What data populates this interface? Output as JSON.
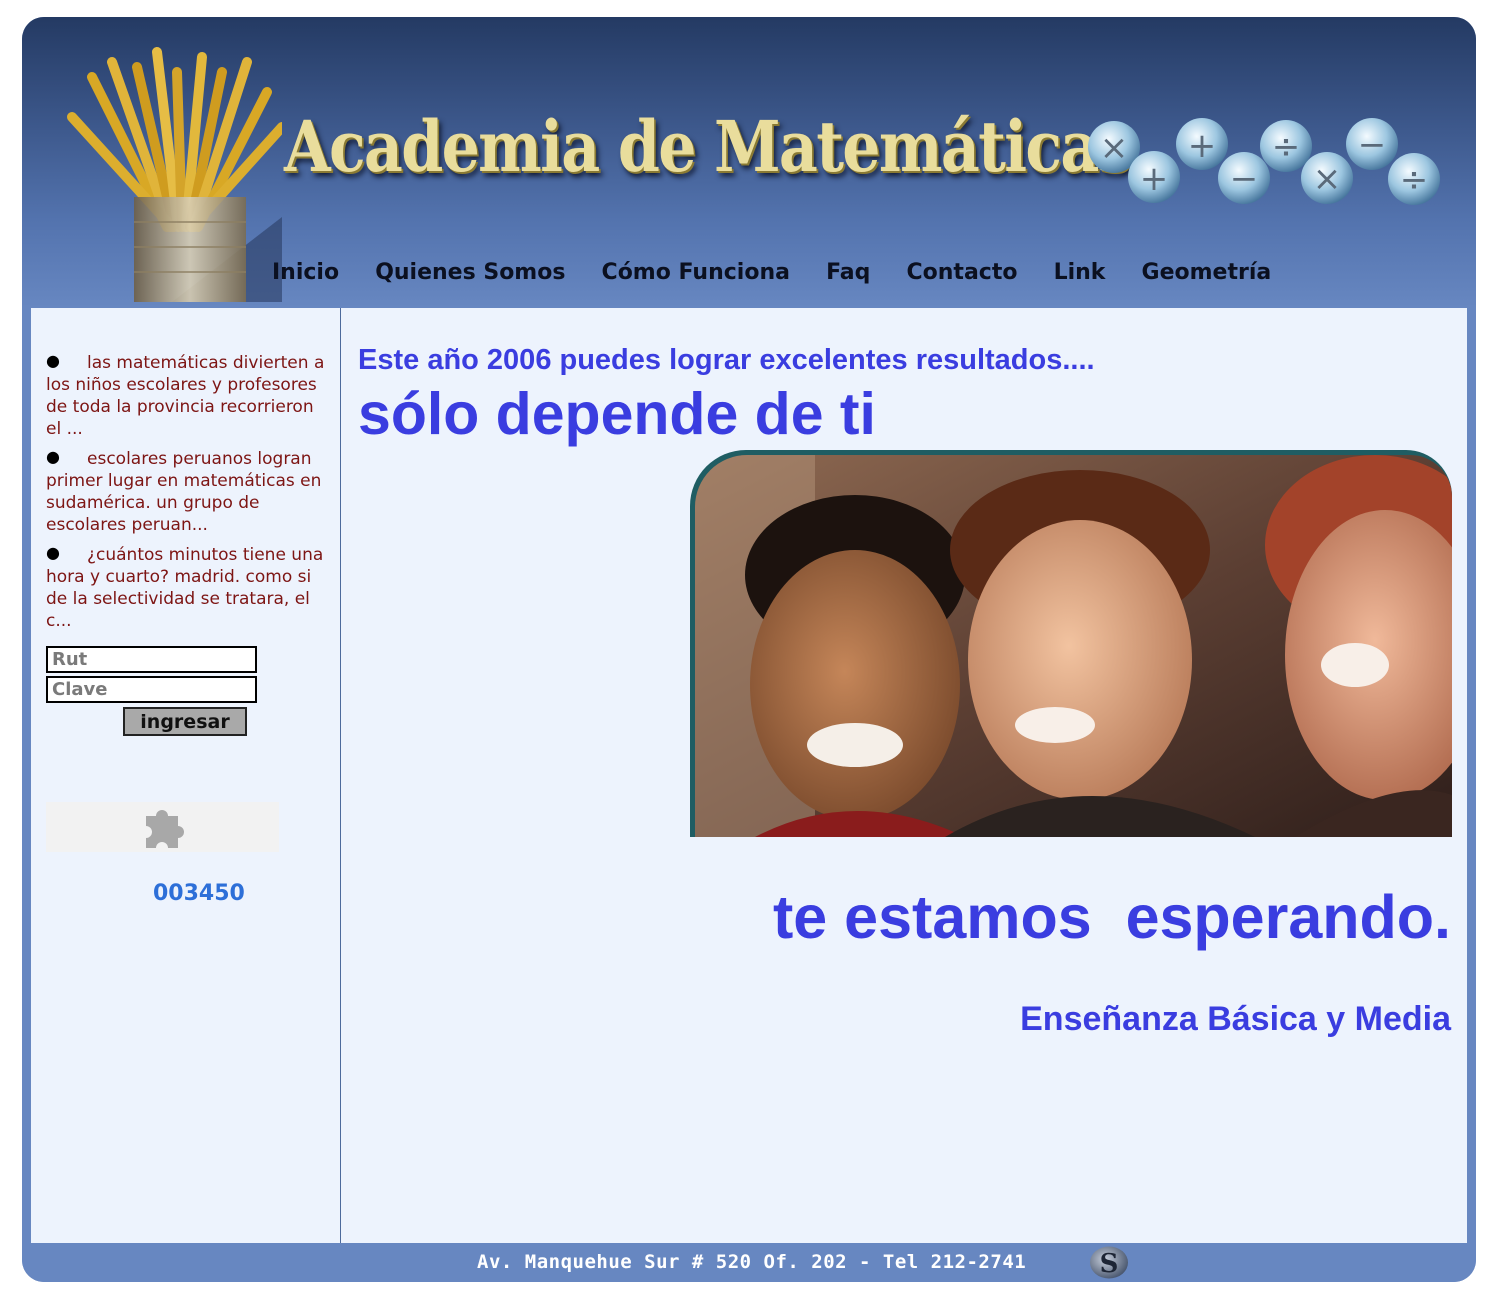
{
  "header": {
    "title": "Academia de Matemáticas"
  },
  "nav": {
    "items": [
      "Inicio",
      "Quienes Somos",
      "Cómo Funciona",
      "Faq",
      "Contacto",
      "Link",
      "Geometría"
    ]
  },
  "sidebar": {
    "news": [
      "las matemáticas divierten a los niños escolares y profesores de toda la provincia recorrieron el ...",
      "escolares peruanos logran primer lugar en matemáticas en sudamérica. un grupo de escolares peruan...",
      "¿cuántos minutos tiene una hora y cuarto? madrid. como si de la selectividad se tratara, el c..."
    ],
    "login": {
      "rut_placeholder": "Rut",
      "clave_placeholder": "Clave",
      "submit_label": "ingresar"
    },
    "plugin_icon": "puzzle-piece-icon",
    "counter": "003450"
  },
  "main": {
    "headline_small": "Este año 2006 puedes lograr excelentes resultados....",
    "headline_big": "sólo depende de ti",
    "tagline": "te estamos  esperando.",
    "subtitle": "Enseñanza Básica y Media"
  },
  "footer": {
    "address": "Av. Manquehue Sur # 520 Of. 202 - Tel 212-2741"
  },
  "colors": {
    "frame": "#6787c1",
    "content_bg": "#edf3fd",
    "headline": "#3a3de0",
    "news_text": "#7d1514",
    "counter": "#2d6fd8",
    "title_gold": "#e9dd9c"
  }
}
